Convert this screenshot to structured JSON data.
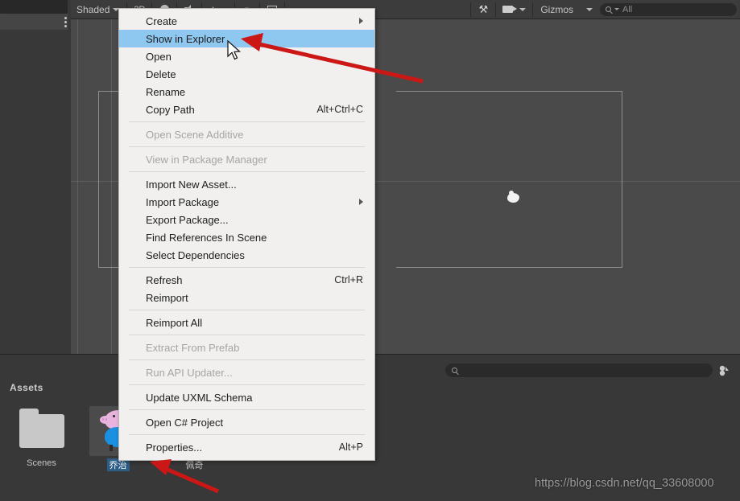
{
  "app": {
    "name": "Unity Editor",
    "watermark": "https://blog.csdn.net/qq_33608000"
  },
  "scene_toolbar": {
    "draw_mode_label": "Shaded",
    "two_d_label": "2D",
    "gizmos_label": "Gizmos",
    "search_placeholder": "All",
    "search_value": "",
    "icons": [
      "chevron-down-icon",
      "lighting-icon",
      "audio-icon",
      "effects-icon",
      "chevron-down-icon",
      "scene-visibility-icon",
      "camera-overlay-icon",
      "tools-icon",
      "camera-icon"
    ]
  },
  "context_menu": {
    "items": [
      {
        "label": "Create",
        "shortcut": "",
        "state": "submenu"
      },
      {
        "label": "Show in Explorer",
        "shortcut": "",
        "state": "highlight"
      },
      {
        "label": "Open",
        "shortcut": "",
        "state": "normal"
      },
      {
        "label": "Delete",
        "shortcut": "",
        "state": "normal"
      },
      {
        "label": "Rename",
        "shortcut": "",
        "state": "normal"
      },
      {
        "label": "Copy Path",
        "shortcut": "Alt+Ctrl+C",
        "state": "normal"
      },
      {
        "label": "",
        "shortcut": "",
        "state": "separator"
      },
      {
        "label": "Open Scene Additive",
        "shortcut": "",
        "state": "disabled"
      },
      {
        "label": "",
        "shortcut": "",
        "state": "separator"
      },
      {
        "label": "View in Package Manager",
        "shortcut": "",
        "state": "disabled"
      },
      {
        "label": "",
        "shortcut": "",
        "state": "separator"
      },
      {
        "label": "Import New Asset...",
        "shortcut": "",
        "state": "normal"
      },
      {
        "label": "Import Package",
        "shortcut": "",
        "state": "submenu"
      },
      {
        "label": "Export Package...",
        "shortcut": "",
        "state": "normal"
      },
      {
        "label": "Find References In Scene",
        "shortcut": "",
        "state": "normal"
      },
      {
        "label": "Select Dependencies",
        "shortcut": "",
        "state": "normal"
      },
      {
        "label": "",
        "shortcut": "",
        "state": "separator"
      },
      {
        "label": "Refresh",
        "shortcut": "Ctrl+R",
        "state": "normal"
      },
      {
        "label": "Reimport",
        "shortcut": "",
        "state": "normal"
      },
      {
        "label": "",
        "shortcut": "",
        "state": "separator"
      },
      {
        "label": "Reimport All",
        "shortcut": "",
        "state": "normal"
      },
      {
        "label": "",
        "shortcut": "",
        "state": "separator"
      },
      {
        "label": "Extract From Prefab",
        "shortcut": "",
        "state": "disabled"
      },
      {
        "label": "",
        "shortcut": "",
        "state": "separator"
      },
      {
        "label": "Run API Updater...",
        "shortcut": "",
        "state": "disabled"
      },
      {
        "label": "",
        "shortcut": "",
        "state": "separator"
      },
      {
        "label": "Update UXML Schema",
        "shortcut": "",
        "state": "normal"
      },
      {
        "label": "",
        "shortcut": "",
        "state": "separator"
      },
      {
        "label": "Open C# Project",
        "shortcut": "",
        "state": "normal"
      },
      {
        "label": "",
        "shortcut": "",
        "state": "separator"
      },
      {
        "label": "Properties...",
        "shortcut": "Alt+P",
        "state": "normal"
      }
    ]
  },
  "project_panel": {
    "title": "Assets",
    "search_value": "",
    "search_placeholder": "",
    "assets": [
      {
        "name": "Scenes",
        "kind": "folder",
        "selected": false
      },
      {
        "name": "乔治",
        "kind": "prefab-george",
        "selected": true
      },
      {
        "name": "佩奇",
        "kind": "prefab-peppa",
        "selected": false
      }
    ]
  },
  "colors": {
    "menu_background": "#f1f0ef",
    "menu_highlight": "#8ec7f0",
    "editor_background": "#383838",
    "scene_background": "#4a4a4a",
    "selection_blue": "#2c5d87",
    "annotation_red": "#cc1717"
  }
}
